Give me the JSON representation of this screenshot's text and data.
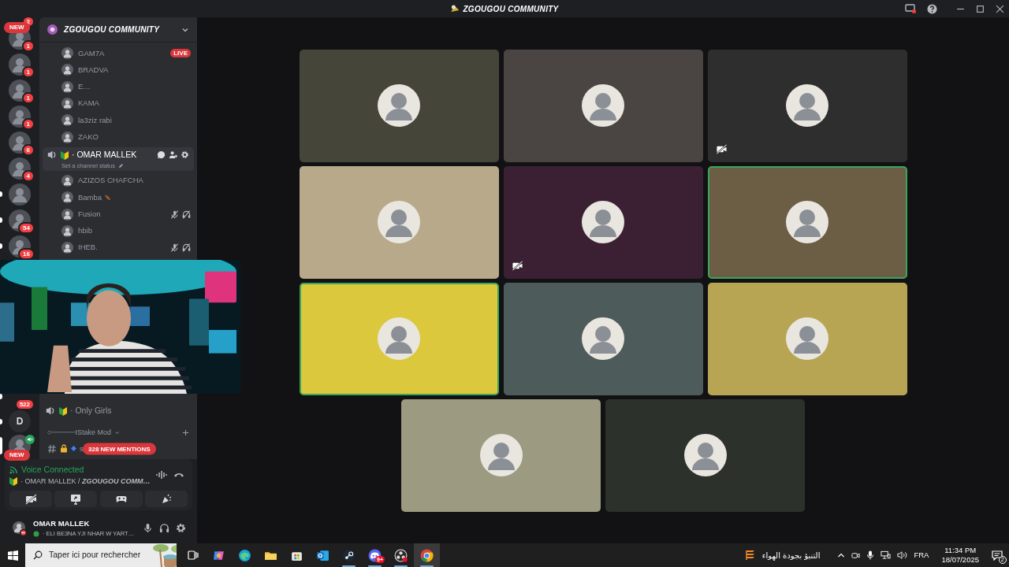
{
  "window": {
    "title": "ZGOUGOU COMMUNITY"
  },
  "servers_top": [
    {
      "kind": "edge",
      "badge": "2",
      "unread": false,
      "selected": false
    },
    {
      "kind": "avatar",
      "badge": "1",
      "new_label": "NEW",
      "unread": false,
      "selected": false
    },
    {
      "kind": "avatar",
      "badge": "1",
      "unread": false,
      "selected": false
    },
    {
      "kind": "avatar",
      "badge": "1",
      "unread": false,
      "selected": false
    },
    {
      "kind": "avatar",
      "badge": "1",
      "unread": false,
      "selected": false
    },
    {
      "kind": "avatar",
      "badge": "6",
      "unread": false,
      "selected": false
    },
    {
      "kind": "avatar",
      "badge": "4",
      "unread": false,
      "selected": false
    },
    {
      "kind": "avatar",
      "unread": true,
      "selected": false
    },
    {
      "kind": "avatar",
      "badge": "54",
      "unread": true,
      "selected": false
    },
    {
      "kind": "avatar",
      "badge": "16",
      "unread": true,
      "selected": false
    }
  ],
  "servers_bottom": [
    {
      "kind": "covered",
      "badge": "522",
      "unread": true,
      "selected": false
    },
    {
      "kind": "letter",
      "letter": "D",
      "unread": true,
      "selected": false
    },
    {
      "kind": "avatar",
      "new_label": "NEW",
      "speaking": true,
      "unread": false,
      "selected": true
    }
  ],
  "channel_list": {
    "server_name": "ZGOUGOU COMMUNITY",
    "members_above": [
      {
        "name": "GAM7A",
        "live": "LIVE"
      },
      {
        "name": "BRADVA"
      },
      {
        "name": "E…"
      },
      {
        "name": "KAMA"
      },
      {
        "name": "la3ziz rabi"
      },
      {
        "name": "ZAKO"
      }
    ],
    "channel": {
      "name": "· OMAR MALLEK",
      "status": "Set a channel status"
    },
    "members": [
      {
        "name": "AZIZOS CHAFCHA",
        "flair": false,
        "muted": false,
        "deafened": false
      },
      {
        "name": "Bamba",
        "flair": true,
        "muted": false,
        "deafened": false
      },
      {
        "name": "Fusion",
        "flair": false,
        "muted": true,
        "deafened": true
      },
      {
        "name": "hbib",
        "flair": false,
        "muted": false,
        "deafened": false
      },
      {
        "name": "IHEB.",
        "flair": false,
        "muted": true,
        "deafened": true
      }
    ],
    "more_channels": [
      {
        "kind": "voice",
        "name": "· Only Girls"
      },
      {
        "kind": "category",
        "name": "○┄┄┄┄┄┄IStake Mod"
      },
      {
        "kind": "text",
        "name": "s"
      }
    ],
    "mentions_pill": "328 NEW MENTIONS"
  },
  "voice_panel": {
    "status": "Voice Connected",
    "channel": "· OMAR MALLEK /",
    "server": "ZGOUGOU COMM…",
    "buttons": [
      {
        "kind": "camera"
      },
      {
        "kind": "screen"
      },
      {
        "kind": "activity"
      },
      {
        "kind": "soundboard"
      }
    ]
  },
  "user_panel": {
    "name": "OMAR MALLEK",
    "status": "· ELI BE3NA YJI NHAR W YART…"
  },
  "tiles": [
    {
      "color": "#46453a",
      "speaking": false,
      "video_off": false
    },
    {
      "color": "#4a4542",
      "speaking": false,
      "video_off": false
    },
    {
      "color": "#2e2e2e",
      "speaking": false,
      "video_off": true
    },
    {
      "color": "#b9a98b",
      "speaking": false,
      "video_off": false
    },
    {
      "color": "#3b2034",
      "speaking": false,
      "video_off": true
    },
    {
      "color": "#6c5d45",
      "speaking": true,
      "video_off": false
    },
    {
      "color": "#dbc83d",
      "speaking": true,
      "video_off": false
    },
    {
      "color": "#4d5b5b",
      "speaking": false,
      "video_off": false
    },
    {
      "color": "#b7a554",
      "speaking": false,
      "video_off": false
    },
    {
      "color": "#9c9b81",
      "speaking": false,
      "video_off": false
    },
    {
      "color": "#2c312b",
      "speaking": false,
      "video_off": false
    }
  ],
  "taskbar": {
    "search_placeholder": "Taper ici pour rechercher",
    "apps": [
      {
        "kind": "copilot",
        "running": false,
        "selected": false
      },
      {
        "kind": "edge",
        "running": false,
        "selected": false
      },
      {
        "kind": "explorer",
        "running": false,
        "selected": false
      },
      {
        "kind": "store",
        "running": false,
        "selected": false
      },
      {
        "kind": "outlook",
        "running": false,
        "selected": false
      },
      {
        "kind": "steam",
        "running": true,
        "selected": false
      },
      {
        "kind": "discord",
        "running": true,
        "selected": false,
        "badge": "9+"
      },
      {
        "kind": "recorder",
        "running": true,
        "selected": false
      },
      {
        "kind": "chrome",
        "running": true,
        "selected": true
      }
    ],
    "weather_text": "التنبؤ بجودة الهواء",
    "language": "FRA",
    "time": "11:34 PM",
    "date": "18/07/2025",
    "notifications": "2"
  }
}
